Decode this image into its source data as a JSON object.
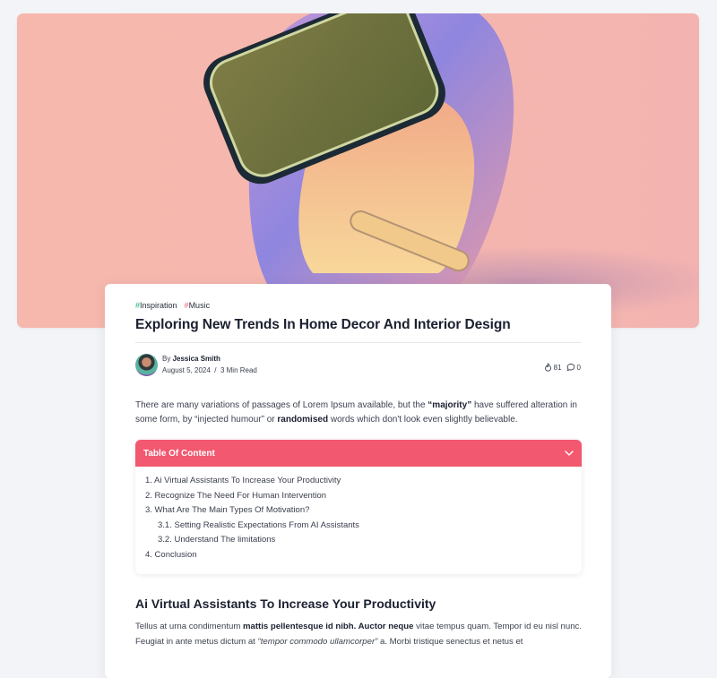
{
  "hero": {
    "image": "smartwatch-band-icon",
    "colors": {
      "background": "#f6b8ad",
      "band": "#8f86df",
      "band_inner": "#f5c98f",
      "screen": "#6f7040"
    }
  },
  "article": {
    "tags": [
      {
        "hash": "#",
        "label": "Inspiration",
        "color": "#18b37f"
      },
      {
        "hash": "#",
        "label": "Music",
        "color": "#ef5a74"
      }
    ],
    "title": "Exploring New Trends In Home Decor And Interior Design",
    "author": {
      "by": "By",
      "name": "Jessica Smith",
      "date": "August 5, 2024",
      "separator": "/",
      "read_time": "3 Min Read"
    },
    "stats": {
      "likes": "81",
      "comments": "0"
    },
    "intro": {
      "p1": "There are many variations of passages of Lorem Ipsum available, but the ",
      "b1": "“majority”",
      "p2": " have suffered alteration in some form, by “injected humour” or ",
      "b2": "randomised",
      "p3": " words which don't look even slightly believable."
    },
    "toc": {
      "title": "Table Of Content",
      "items": [
        "1. Ai Virtual Assistants To Increase Your Productivity",
        "2. Recognize The Need For Human Intervention",
        "3. What Are The Main Types Of Motivation?",
        "3.1. Setting Realistic Expectations From AI Assistants",
        "3.2. Understand The limitations",
        "4. Conclusion"
      ]
    },
    "section": {
      "title": "Ai Virtual Assistants To Increase Your Productivity",
      "p1": "Tellus at urna condimentum ",
      "b1": "mattis pellentesque id nibh. Auctor neque",
      "p2": " vitae tempus quam. Tempor id eu nisl nunc. Feugiat in ante metus dictum at ",
      "i1": "“tempor commodo ullamcorper”",
      "p3": " a. Morbi tristique senectus et netus et"
    }
  }
}
